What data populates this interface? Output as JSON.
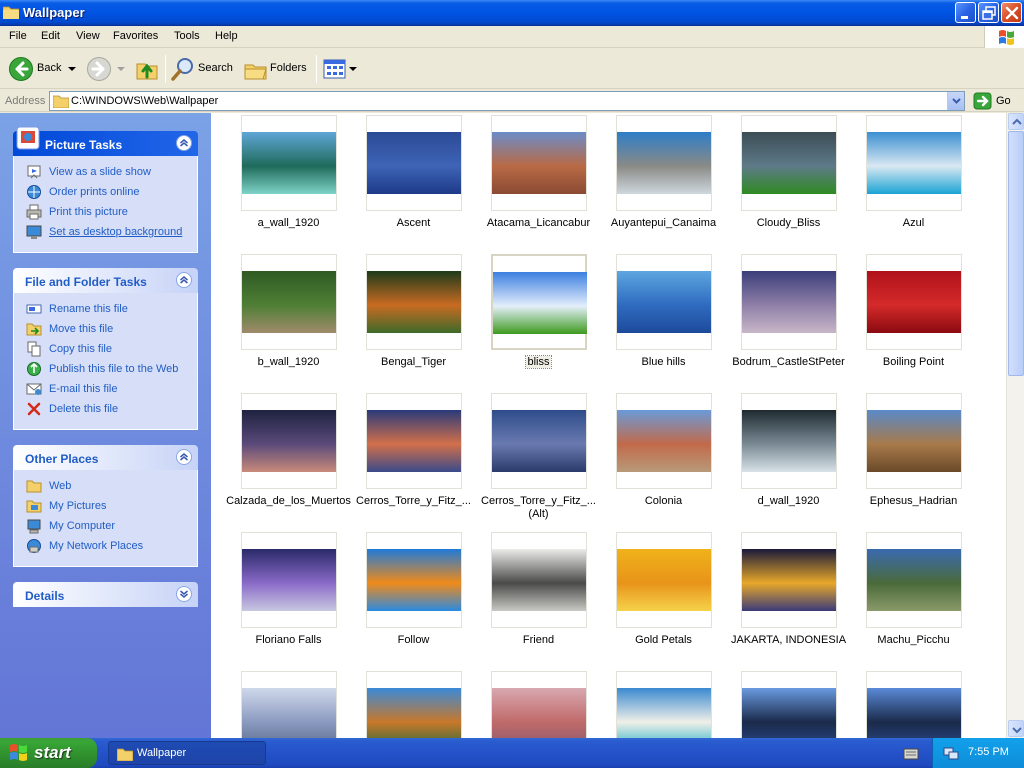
{
  "window": {
    "title": "Wallpaper"
  },
  "menu": {
    "items": [
      "File",
      "Edit",
      "View",
      "Favorites",
      "Tools",
      "Help"
    ]
  },
  "toolbar": {
    "back_label": "Back",
    "search_label": "Search",
    "folders_label": "Folders"
  },
  "address": {
    "label": "Address",
    "value": "C:\\WINDOWS\\Web\\Wallpaper",
    "go_label": "Go"
  },
  "panels": {
    "picture_tasks": {
      "title": "Picture Tasks",
      "items": [
        {
          "label": "View as a slide show",
          "icon": "slideshow-icon"
        },
        {
          "label": "Order prints online",
          "icon": "order-prints-icon"
        },
        {
          "label": "Print this picture",
          "icon": "printer-icon"
        },
        {
          "label": "Set as desktop background",
          "icon": "desktop-icon"
        }
      ]
    },
    "file_folder_tasks": {
      "title": "File and Folder Tasks",
      "items": [
        {
          "label": "Rename this file",
          "icon": "rename-icon"
        },
        {
          "label": "Move this file",
          "icon": "move-icon"
        },
        {
          "label": "Copy this file",
          "icon": "copy-icon"
        },
        {
          "label": "Publish this file to the Web",
          "icon": "publish-web-icon"
        },
        {
          "label": "E-mail this file",
          "icon": "email-icon"
        },
        {
          "label": "Delete this file",
          "icon": "delete-icon"
        }
      ]
    },
    "other_places": {
      "title": "Other Places",
      "items": [
        {
          "label": "Web",
          "icon": "folder-icon"
        },
        {
          "label": "My Pictures",
          "icon": "my-pictures-icon"
        },
        {
          "label": "My Computer",
          "icon": "my-computer-icon"
        },
        {
          "label": "My Network Places",
          "icon": "network-places-icon"
        }
      ]
    },
    "details": {
      "title": "Details"
    }
  },
  "files": [
    {
      "name": "a_wall_1920",
      "colors": [
        "#5fa6d8",
        "#1f6b5a",
        "#7fd3c8"
      ]
    },
    {
      "name": "Ascent",
      "colors": [
        "#2a4a96",
        "#3f64b6",
        "#1d3a88"
      ]
    },
    {
      "name": "Atacama_Licancabur",
      "colors": [
        "#6b8dc8",
        "#b96a45",
        "#8a4a33"
      ]
    },
    {
      "name": "Auyantepui_Canaima",
      "colors": [
        "#2e7dc8",
        "#8a8a86",
        "#cfd8de"
      ]
    },
    {
      "name": "Cloudy_Bliss",
      "colors": [
        "#3c4d56",
        "#5e7a88",
        "#2f8a22"
      ]
    },
    {
      "name": "Azul",
      "colors": [
        "#3a8fd0",
        "#d9e8f2",
        "#1aa3d4"
      ]
    },
    {
      "name": "b_wall_1920",
      "colors": [
        "#2e5a22",
        "#4f7f36",
        "#a08a6a"
      ]
    },
    {
      "name": "Bengal_Tiger",
      "colors": [
        "#1c3a1a",
        "#c96b22",
        "#3e6a2a"
      ]
    },
    {
      "name": "bliss",
      "colors": [
        "#3b7fe0",
        "#e4eefb",
        "#3e9a1e"
      ]
    },
    {
      "name": "Blue hills",
      "colors": [
        "#5da6e0",
        "#2f6bc0",
        "#1d4a9a"
      ]
    },
    {
      "name": "Bodrum_CastleStPeter",
      "colors": [
        "#3a3e7a",
        "#8f7fa8",
        "#c8b6c8"
      ]
    },
    {
      "name": "Boiling Point",
      "colors": [
        "#b0121a",
        "#d42a2a",
        "#8a0a10"
      ]
    },
    {
      "name": "Calzada_de_los_Muertos",
      "colors": [
        "#1e2240",
        "#5a4a7a",
        "#c98a7a"
      ]
    },
    {
      "name": "Cerros_Torre_y_Fitz_...",
      "colors": [
        "#2a3a7a",
        "#d2704a",
        "#3a4a8a"
      ]
    },
    {
      "name": "Cerros_Torre_y_Fitz_...\n(Alt)",
      "colors": [
        "#2e4c8a",
        "#6a7ab0",
        "#2a3a6a"
      ]
    },
    {
      "name": "Colonia",
      "colors": [
        "#6a9ad8",
        "#c26a4a",
        "#b89a7a"
      ]
    },
    {
      "name": "d_wall_1920",
      "colors": [
        "#1e2a30",
        "#7a8a94",
        "#d8e2e8"
      ]
    },
    {
      "name": "Ephesus_Hadrian",
      "colors": [
        "#5a8ac8",
        "#a87a4a",
        "#6a4a2a"
      ]
    },
    {
      "name": "Floriano Falls",
      "colors": [
        "#2a2a6a",
        "#8a6ac8",
        "#c8c8e0"
      ]
    },
    {
      "name": "Follow",
      "colors": [
        "#1e7ad8",
        "#f08a1a",
        "#2a8ae0"
      ]
    },
    {
      "name": "Friend",
      "colors": [
        "#ececea",
        "#4a4a48",
        "#c8c8c4"
      ]
    },
    {
      "name": "Gold Petals",
      "colors": [
        "#f0b21a",
        "#e8941a",
        "#f6d24a"
      ]
    },
    {
      "name": "JAKARTA, INDONESIA",
      "colors": [
        "#1a1a3a",
        "#e8a82a",
        "#3a3a7a"
      ]
    },
    {
      "name": "Machu_Picchu",
      "colors": [
        "#3a6ab0",
        "#4a6a3a",
        "#8a9a6a"
      ]
    },
    {
      "name": "",
      "colors": [
        "#cfd8ea",
        "#8a9ac0",
        "#5a6a8a"
      ]
    },
    {
      "name": "",
      "colors": [
        "#3a8ad8",
        "#c8782a",
        "#2a6a3a"
      ]
    },
    {
      "name": "",
      "colors": [
        "#d8a8b0",
        "#c06a6a",
        "#8a5a6a"
      ]
    },
    {
      "name": "",
      "colors": [
        "#3a8ad0",
        "#f0f0e8",
        "#2ab0c8"
      ]
    },
    {
      "name": "",
      "colors": [
        "#6a9ae0",
        "#1a2a4a",
        "#2a4a8a"
      ]
    },
    {
      "name": "",
      "colors": [
        "#5a8ad8",
        "#1a2a4a",
        "#2a4a8a"
      ]
    }
  ],
  "selected_file": "bliss",
  "taskbar": {
    "start_label": "start",
    "task_label": "Wallpaper",
    "clock": "7:55 PM"
  }
}
